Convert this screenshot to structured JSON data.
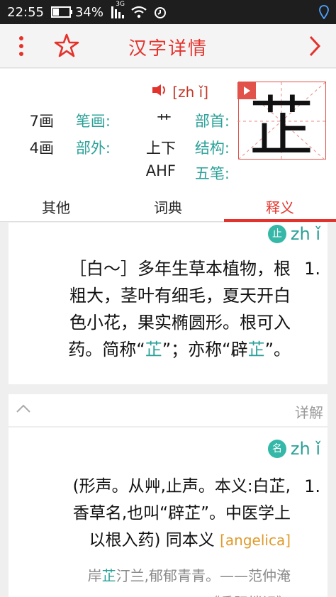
{
  "status_bar": {
    "time": "22:55",
    "battery": "34%",
    "signal_label": "3G"
  },
  "header": {
    "title": "汉字详情"
  },
  "char_info": {
    "character": "芷",
    "pinyin": "[zh ǐ]",
    "bushou_label": "部首:",
    "bushou_value": "艹",
    "bihua_label": "笔画:",
    "bihua_value": "7画",
    "jiegou_label": "结构:",
    "jiegou_value": "上下",
    "buwai_label": "部外:",
    "buwai_value": "4画",
    "wubi_label": "五笔:",
    "wubi_value": "AHF"
  },
  "tabs": [
    {
      "label": "释义",
      "active": true
    },
    {
      "label": "词典",
      "active": false
    },
    {
      "label": "其他",
      "active": false
    }
  ],
  "jianjie": {
    "pinyin": "zh ǐ",
    "badge": "止",
    "num": "1.",
    "lines": [
      "［白～］多年生草本植物，根",
      "粗大，茎叶有细毛，夏天开白",
      "色小花，果实椭圆形。根可入"
    ],
    "line4_a": "药。简称“",
    "line4_hl1": "芷",
    "line4_b": "”；亦称“辟",
    "line4_hl2": "芷",
    "line4_c": "”。"
  },
  "detail": {
    "section_label": "详解",
    "pinyin": "zh ǐ",
    "badge": "名",
    "num": "1.",
    "lines": [
      "(形声。从艸,止声。本义:白芷,",
      "香草名,也叫“辟芷”。中医学上"
    ],
    "line3_a": "以根入药) 同本义 ",
    "line3_orange": "[angelica]",
    "quote_a": "岸",
    "quote_hl": "芷",
    "quote_b": "汀兰,郁郁青青。——范仲淹",
    "quote2": "《岳阳楼记》"
  }
}
